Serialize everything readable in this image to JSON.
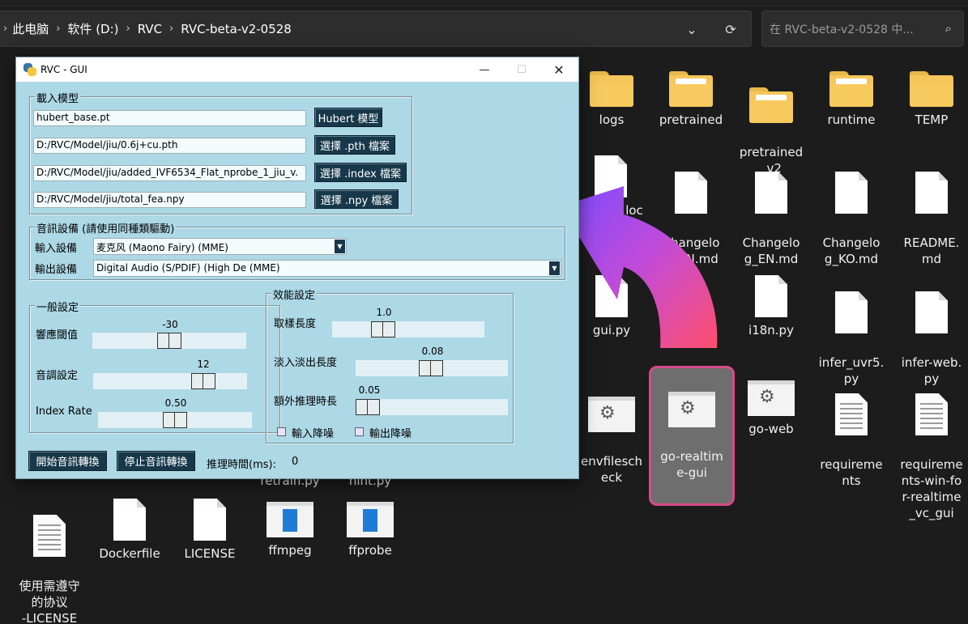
{
  "explorer": {
    "breadcrumbs": [
      "此电脑",
      "软件 (D:)",
      "RVC",
      "RVC-beta-v2-0528"
    ],
    "search_placeholder": "在 RVC-beta-v2-0528 中...",
    "items": {
      "logs": "logs",
      "pretrained": "pretrained",
      "pretrained_v2": "pretrained\n_v2",
      "runtime": "runtime",
      "temp": "TEMP",
      "doc_partial": "loc",
      "changelog_cn": "Changelo\ng_CN.md",
      "changelog_en": "Changelo\ng_EN.md",
      "changelog_ko": "Changelo\ng_KO.md",
      "readme": "README.\nmd",
      "gui_py": "gui.py",
      "i18n_py": "i18n.py",
      "infer_uvr5": "infer_uvr5.\npy",
      "infer_web": "infer-web.\npy",
      "envfilescheck": "envfilesch\neck",
      "go_realtime_gui": "go-realtim\ne-gui",
      "go_web": "go-web",
      "requirements": "requireme\nnts",
      "requirements_win": "requireme\nnts-win-fo\nr-realtime\n_vc_gui",
      "retrain_py": "retrain.py",
      "hint_py": "nint.py",
      "license_cn": "使用需遵守\n的协议\n-LICENSE",
      "dockerfile": "Dockerfile",
      "license": "LICENSE",
      "ffmpeg": "ffmpeg",
      "ffprobe": "ffprobe"
    }
  },
  "gui": {
    "title": "RVC - GUI",
    "load_model": {
      "title": "載入模型",
      "hubert_path": "hubert_base.pt",
      "hubert_btn": "Hubert 模型",
      "pth_path": "D:/RVC/Model/jiu/0.6j+cu.pth",
      "pth_btn": "選擇 .pth 檔案",
      "index_path": "D:/RVC/Model/jiu/added_IVF6534_Flat_nprobe_1_jiu_v.",
      "index_btn": "選擇 .index 檔案",
      "npy_path": "D:/RVC/Model/jiu/total_fea.npy",
      "npy_btn": "選擇 .npy 檔案"
    },
    "audio": {
      "title": "音訊設備 (請使用同種類驅動)",
      "input_label": "輸入設備",
      "input_value": "麦克风 (Maono Fairy) (MME)",
      "output_label": "輸出設備",
      "output_value": "Digital Audio (S/PDIF) (High De (MME)"
    },
    "general": {
      "title": "一般設定",
      "threshold_label": "響應閾值",
      "threshold_value": "-30",
      "pitch_label": "音調設定",
      "pitch_value": "12",
      "index_label": "Index Rate",
      "index_value": "0.50"
    },
    "perf": {
      "title": "效能設定",
      "sample_label": "取樣長度",
      "sample_value": "1.0",
      "fade_label": "淡入淡出長度",
      "fade_value": "0.08",
      "extra_label": "額外推理時長",
      "extra_value": "0.05",
      "in_denoise": "輸入降噪",
      "out_denoise": "輸出降噪"
    },
    "start_btn": "開始音訊轉換",
    "stop_btn": "停止音訊轉換",
    "infer_time_label": "推理時間(ms):",
    "infer_time_value": "0"
  },
  "colors": {
    "window_bg": "#add8e6",
    "button_bg": "#17384a",
    "selection_border": "#d84a8c",
    "folder": "#f5c65a"
  }
}
